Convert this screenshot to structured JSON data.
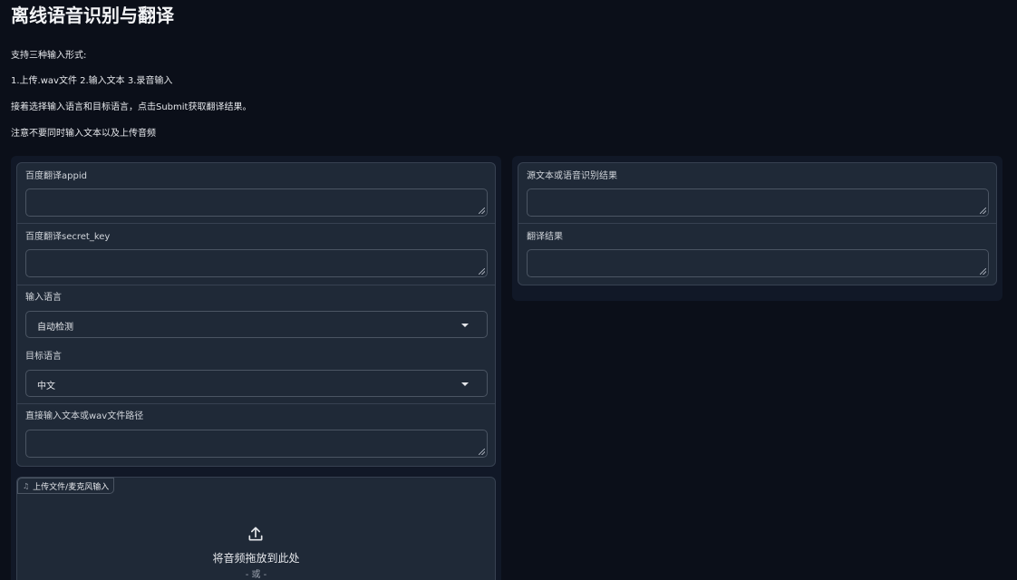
{
  "page": {
    "title": "离线语音识别与翻译",
    "description": [
      "支持三种输入形式:",
      "1.上传.wav文件 2.输入文本 3.录音输入",
      "接着选择输入语言和目标语言，点击Submit获取翻译结果。",
      "注意不要同时输入文本以及上传音频"
    ]
  },
  "inputs": {
    "appid_label": "百度翻译appid",
    "appid_value": "",
    "secret_label": "百度翻译secret_key",
    "secret_value": "",
    "source_lang_label": "输入语言",
    "source_lang_value": "自动检测",
    "target_lang_label": "目标语言",
    "target_lang_value": "中文",
    "text_label": "直接输入文本或wav文件路径",
    "text_value": ""
  },
  "upload": {
    "tag_icon": "music-note-icon",
    "tag_label": "上传文件/麦克风输入",
    "drop_text": "将音频拖放到此处",
    "or_text": "- 或 -"
  },
  "outputs": {
    "source_label": "源文本或语音识别结果",
    "source_value": "",
    "translation_label": "翻译结果",
    "translation_value": ""
  },
  "colors": {
    "background": "#0b0f19",
    "panel": "#1f2937",
    "border": "#374151"
  }
}
